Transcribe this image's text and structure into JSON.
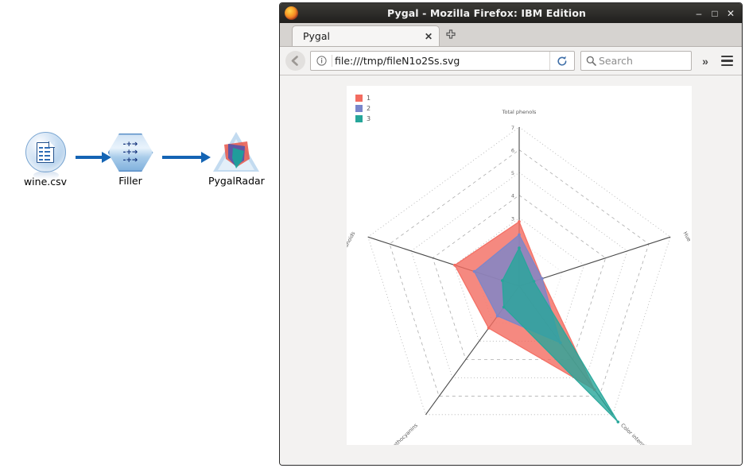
{
  "stream": {
    "nodes": [
      {
        "label": "wine.csv",
        "icon": "csv-document-icon"
      },
      {
        "label": "Filler",
        "icon": "filler-hexagon-icon",
        "rows": [
          "-+➔",
          "-+➔",
          "-+➔"
        ]
      },
      {
        "label": "PygalRadar",
        "icon": "pygal-radar-triangle-icon"
      }
    ],
    "connectors": [
      "arrow-right",
      "arrow-right"
    ],
    "accent_color": "#1464b4"
  },
  "browser": {
    "window_title": "Pygal - Mozilla Firefox: IBM Edition",
    "window_controls": {
      "minimize": "–",
      "maximize": "□",
      "close": "✕"
    },
    "tabs": [
      {
        "label": "Pygal",
        "close_label": "✕",
        "active": true
      }
    ],
    "new_tab_label": "✚",
    "nav": {
      "back_label": "←",
      "identity_label": "ⓘ",
      "url": "file:///tmp/fileN1o2Ss.svg",
      "reload_label": "↻",
      "search_placeholder": "Search",
      "overflow_label": "»",
      "menu_label": "menu"
    }
  },
  "chart_data": {
    "type": "radar",
    "title": "",
    "categories": [
      "Total phenols",
      "Hue",
      "Color intensity",
      "Proanthocyanins",
      "Flavanoids"
    ],
    "tick_labels": [
      "7",
      "6",
      "5",
      "4",
      "3"
    ],
    "tick_values": [
      7,
      6,
      5,
      4,
      3
    ],
    "rlim": [
      0,
      7
    ],
    "grid": true,
    "legend_position": "top-left",
    "series": [
      {
        "name": "1",
        "color": "#F36C60",
        "values": [
          2.84,
          1.06,
          5.64,
          2.29,
          2.98
        ]
      },
      {
        "name": "2",
        "color": "#7986CB",
        "values": [
          2.26,
          1.06,
          3.09,
          1.63,
          2.08
        ]
      },
      {
        "name": "3",
        "color": "#26A69A",
        "values": [
          1.68,
          0.68,
          7.4,
          1.15,
          0.78
        ]
      }
    ],
    "axis_label_color": "#5a5a5a",
    "background": "#ffffff"
  }
}
